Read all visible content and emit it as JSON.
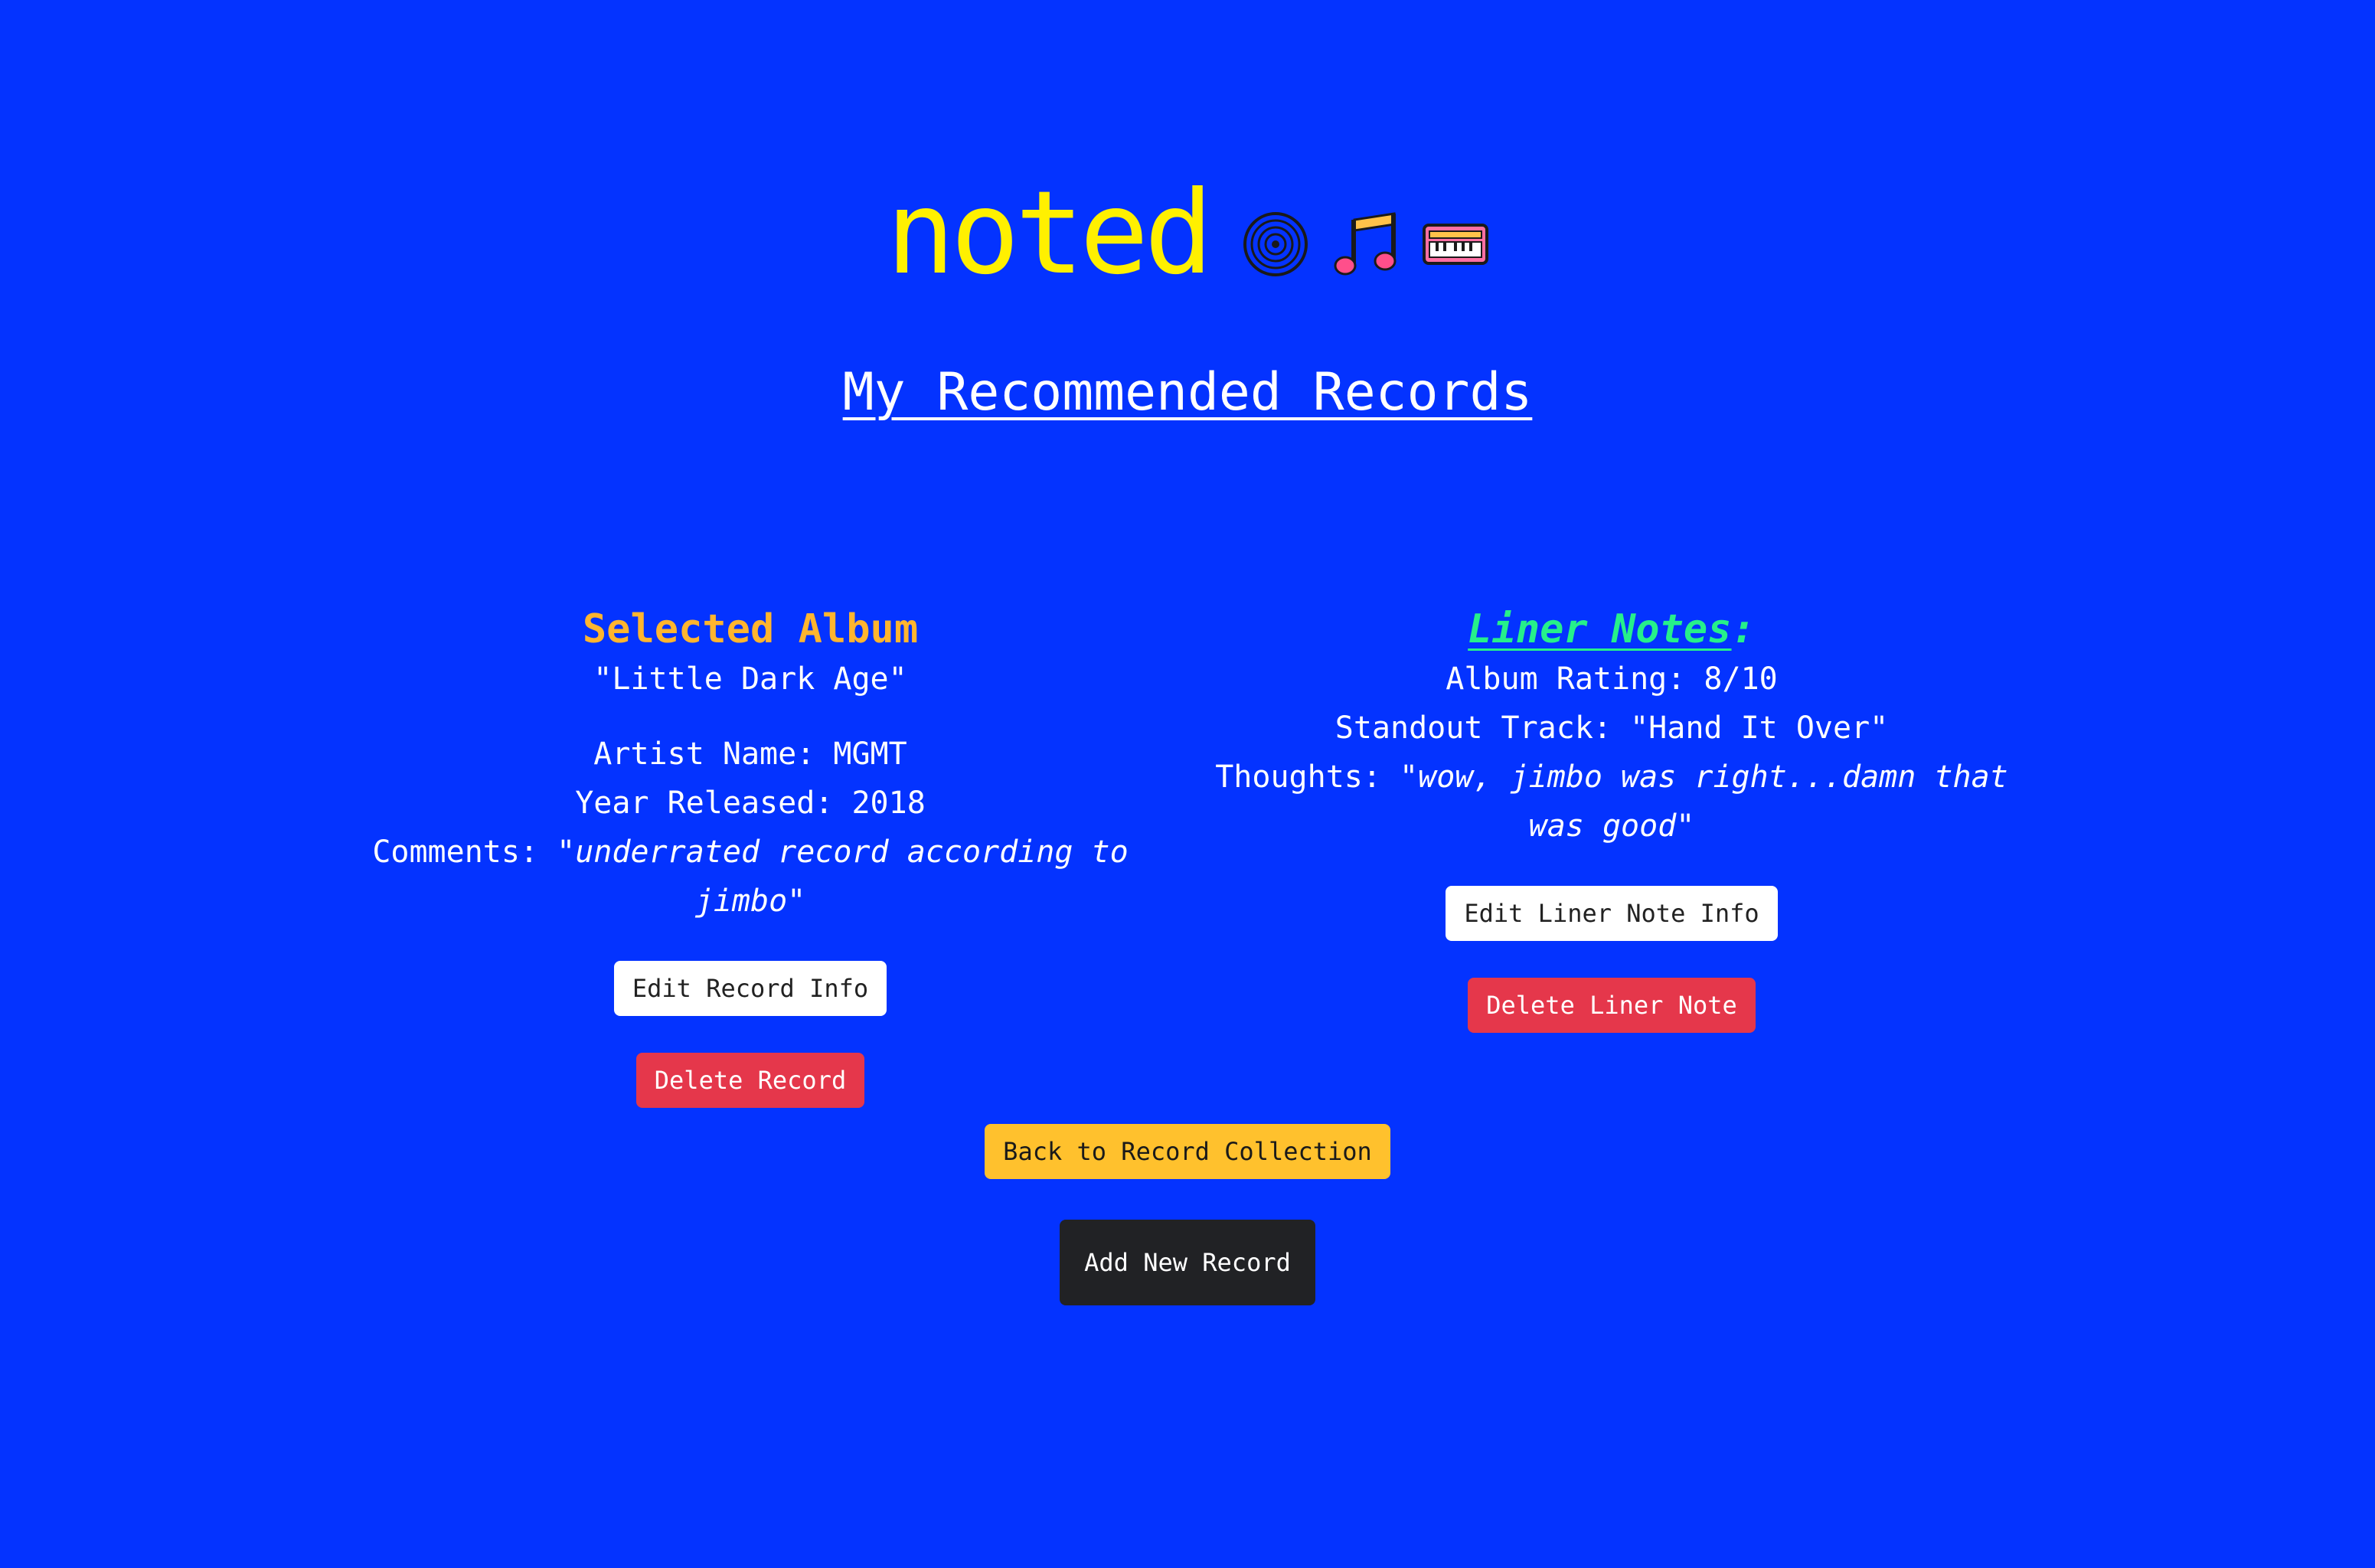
{
  "header": {
    "brand": "noted",
    "icons": [
      "vinyl-record-icon",
      "music-notes-icon",
      "keyboard-icon"
    ],
    "subtitle": "My Recommended Records"
  },
  "album": {
    "section_title": "Selected Album",
    "title": "\"Little Dark Age\"",
    "artist_label": "Artist Name: ",
    "artist_value": "MGMT",
    "year_label": "Year Released: ",
    "year_value": "2018",
    "comments_label": "Comments: ",
    "comments_value": "\"underrated record according to jimbo\"",
    "edit_label": "Edit Record Info",
    "delete_label": "Delete Record"
  },
  "liner_notes": {
    "section_title": "Liner Notes",
    "section_suffix": ":",
    "rating_label": "Album Rating: ",
    "rating_value": "8/10",
    "standout_label": "Standout Track: ",
    "standout_value": "\"Hand It Over\"",
    "thoughts_label": "Thoughts: ",
    "thoughts_value": "\"wow, jimbo was right...damn that was good\"",
    "edit_label": "Edit Liner Note Info",
    "delete_label": "Delete Liner Note"
  },
  "footer": {
    "back_label": "Back to Record Collection",
    "add_label": "Add New Record"
  },
  "colors": {
    "background": "#0433ff",
    "brand": "#fff000",
    "album_title": "#ffb52e",
    "liner_title": "#26f08a",
    "danger": "#e5374b",
    "warning": "#ffc12d",
    "dark": "#212225"
  }
}
